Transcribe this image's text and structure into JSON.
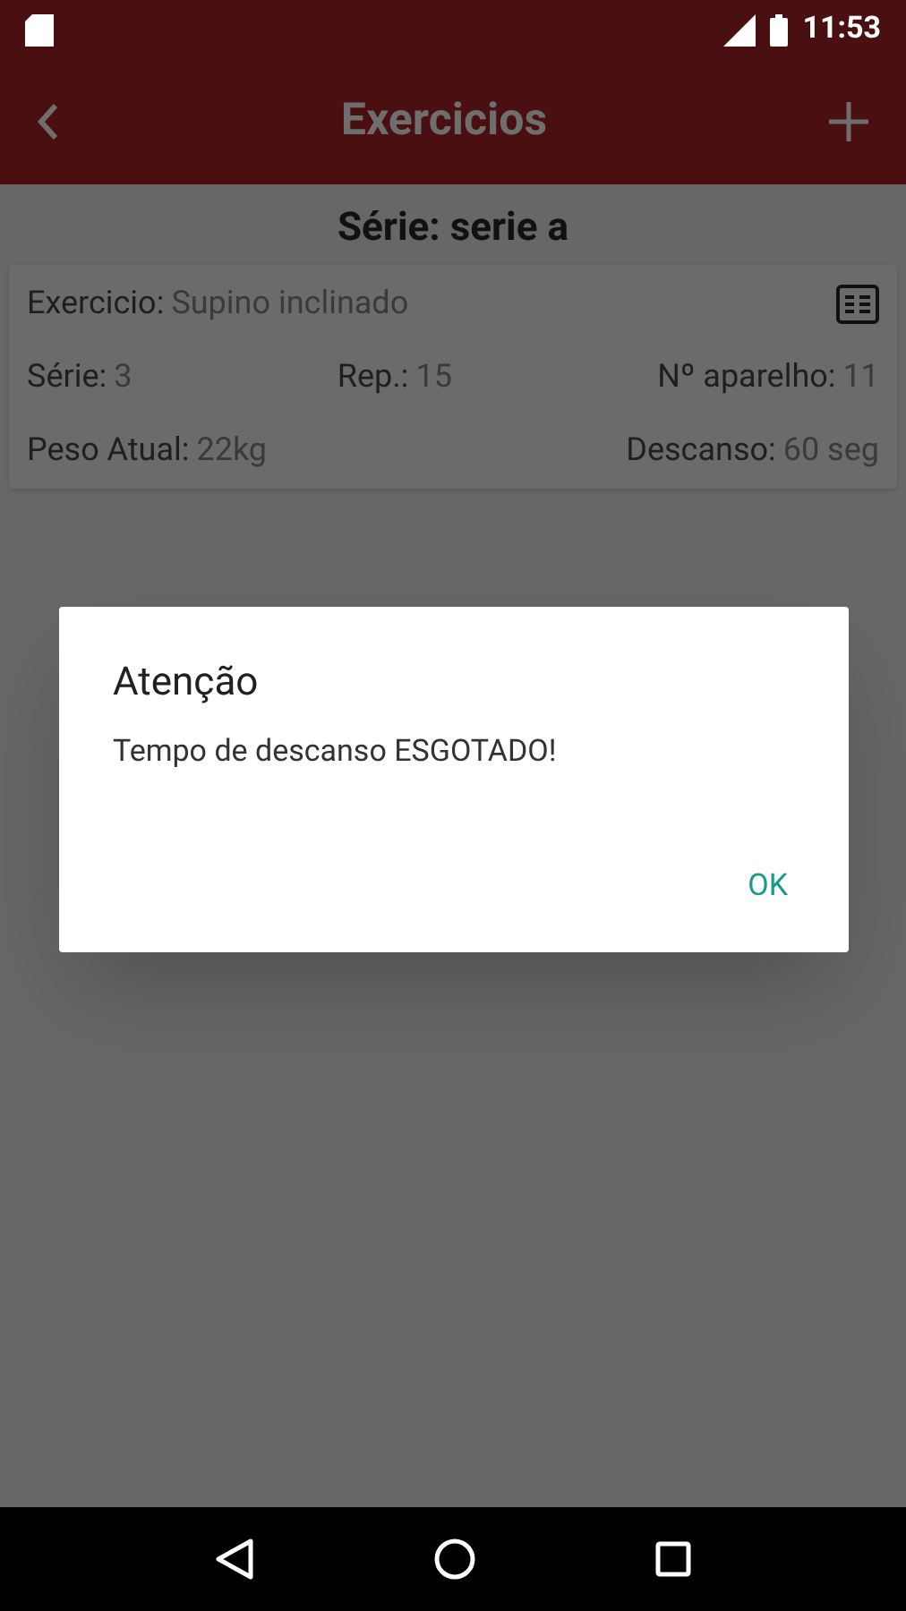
{
  "status_bar": {
    "time": "11:53"
  },
  "app_bar": {
    "title": "Exercicios"
  },
  "heading": "Série: serie a",
  "card": {
    "exercise": {
      "label": "Exercicio:",
      "value": "Supino inclinado"
    },
    "series": {
      "label": "Série:",
      "value": "3"
    },
    "reps": {
      "label": "Rep.:",
      "value": "15"
    },
    "device": {
      "label": "Nº aparelho:",
      "value": "11"
    },
    "weight": {
      "label": "Peso Atual:",
      "value": "22kg"
    },
    "rest": {
      "label": "Descanso:",
      "value": "60 seg"
    }
  },
  "dialog": {
    "title": "Atenção",
    "message": "Tempo de descanso ESGOTADO!",
    "buttons": [
      "OK"
    ]
  }
}
